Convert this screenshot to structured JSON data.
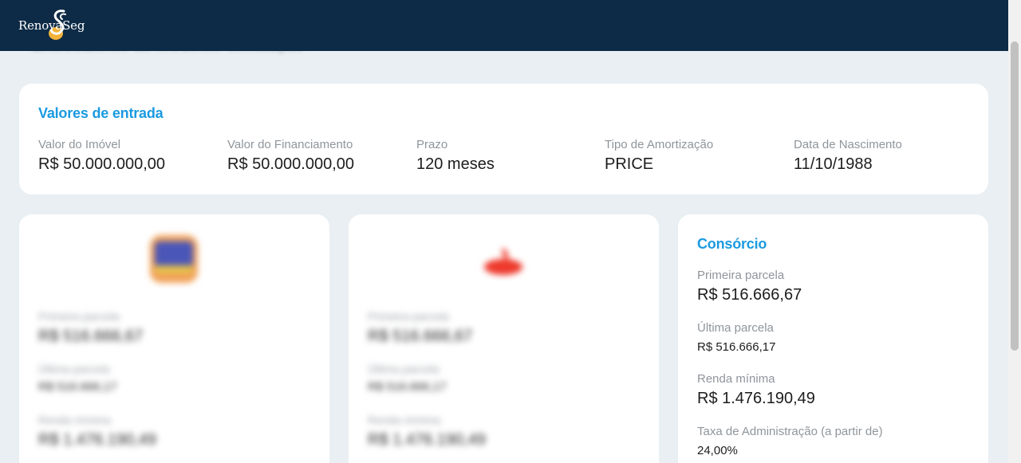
{
  "header": {
    "logo_text": "RenovaSeg",
    "brand_color": "#0d2b46"
  },
  "behind_title": "Entrevalores de modelos simulação",
  "entry": {
    "title": "Valores de entrada",
    "fields": [
      {
        "label": "Valor do Imóvel",
        "value": "R$ 50.000.000,00"
      },
      {
        "label": "Valor do Financiamento",
        "value": "R$ 50.000.000,00"
      },
      {
        "label": "Prazo",
        "value": "120 meses"
      },
      {
        "label": "Tipo de Amortização",
        "value": "PRICE"
      },
      {
        "label": "Data de Nascimento",
        "value": "11/10/1988"
      }
    ]
  },
  "bank_cards": [
    {
      "logo_icon": "bank-logo-blue-yellow-icon",
      "rows": [
        {
          "label": "Primeira parcela",
          "value": "R$ 516.666,67"
        },
        {
          "label": "Última parcela",
          "value": "R$ 516.666,17"
        },
        {
          "label": "Renda mínima",
          "value": "R$ 1.476.190,49"
        }
      ]
    },
    {
      "logo_icon": "bank-logo-red-flame-icon",
      "rows": [
        {
          "label": "Primeira parcela",
          "value": "R$ 516.666,67"
        },
        {
          "label": "Última parcela",
          "value": "R$ 516.666,17"
        },
        {
          "label": "Renda mínima",
          "value": "R$ 1.476.190,49"
        }
      ]
    }
  ],
  "consorcio": {
    "title": "Consórcio",
    "primeira_parcela_label": "Primeira parcela",
    "primeira_parcela_value": "R$ 516.666,67",
    "ultima_parcela_label": "Última parcela",
    "ultima_parcela_value": "R$ 516.666,17",
    "renda_minima_label": "Renda mínima",
    "renda_minima_value": "R$ 1.476.190,49",
    "taxa_label": "Taxa de Administração (a partir de)",
    "taxa_value": "24,00%"
  },
  "colors": {
    "accent": "#1a9ae0",
    "page_background": "#e9eff2"
  }
}
